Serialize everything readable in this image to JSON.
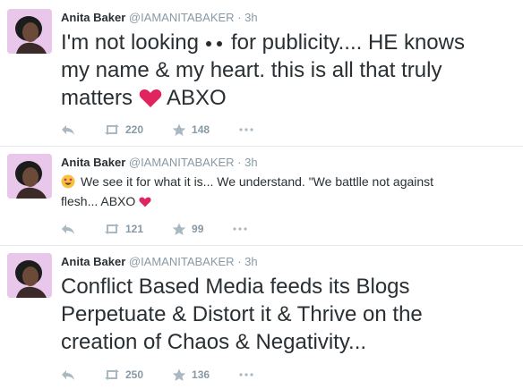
{
  "tweets": [
    {
      "name": "Anita Baker",
      "handle": "@IAMANITABAKER",
      "dot": "·",
      "time": "3h",
      "text_lines": [
        {
          "before": "I'm not looking",
          "after": "for publicity.... HE knows"
        },
        {
          "text": "my name & my heart. this is all that truly"
        },
        {
          "before": "matters",
          "after": "ABXO"
        }
      ],
      "retweets": "220",
      "favorites": "148",
      "reply_icon": "reply-icon",
      "retweet_icon": "retweet-icon",
      "favorite_icon": "star-icon",
      "more_icon": "more-icon"
    },
    {
      "name": "Anita Baker",
      "handle": "@IAMANITABAKER",
      "dot": "·",
      "time": "3h",
      "text_lines": [
        {
          "text": "We see it for what it is...  We understand. \"We battlle not against"
        },
        {
          "text": "flesh... ABXO"
        }
      ],
      "retweets": "121",
      "favorites": "99",
      "reply_icon": "reply-icon",
      "retweet_icon": "retweet-icon",
      "favorite_icon": "star-icon",
      "more_icon": "more-icon"
    },
    {
      "name": "Anita Baker",
      "handle": "@IAMANITABAKER",
      "dot": "·",
      "time": "3h",
      "text_lines": [
        {
          "text": "Conflict Based Media feeds its Blogs"
        },
        {
          "text": "Perpetuate & Distort it & Thrive on the"
        },
        {
          "text": "creation of Chaos & Negativity..."
        }
      ],
      "retweets": "250",
      "favorites": "136",
      "reply_icon": "reply-icon",
      "retweet_icon": "retweet-icon",
      "favorite_icon": "star-icon",
      "more_icon": "more-icon"
    }
  ],
  "colors": {
    "text": "#292f33",
    "muted": "#8899a6",
    "heart": "#e0245e",
    "divider": "#e1e8ed"
  }
}
